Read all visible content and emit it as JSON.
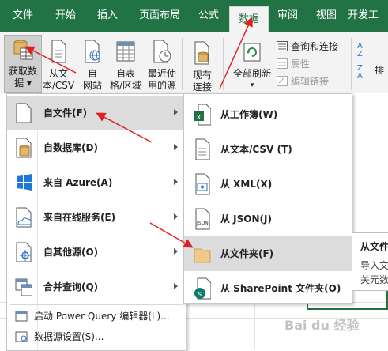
{
  "tabs": [
    "文件",
    "开始",
    "插入",
    "页面布局",
    "公式",
    "数据",
    "审阅",
    "视图",
    "开发工"
  ],
  "active_tab": "数据",
  "ribbon": {
    "get_data": [
      "获取数",
      "据 ▾"
    ],
    "from_text": [
      "从文",
      "本/CSV"
    ],
    "from_web": [
      "自",
      "网站"
    ],
    "from_table": [
      "自表",
      "格/区域"
    ],
    "recent_sources": [
      "最近使",
      "用的源"
    ],
    "existing_conn": [
      "现有",
      "连接"
    ],
    "refresh_all": [
      "全部刷新",
      "▾"
    ],
    "queries_conn": "查询和连接",
    "properties": "属性",
    "edit_links": "编辑链接",
    "sort_label": "排"
  },
  "menu": {
    "from_file": "自文件(F)",
    "from_database": "自数据库(D)",
    "from_azure": "来自 Azure(A)",
    "from_online": "来自在线服务(E)",
    "from_other": "自其他源(O)",
    "combine_queries": "合并查询(Q)",
    "launch_pq": "启动 Power Query 编辑器(L)...",
    "data_source_settings": "数据源设置(S)..."
  },
  "submenu": {
    "from_workbook": "从工作簿(W)",
    "from_text_csv": "从文本/CSV (T)",
    "from_xml": "从 XML(X)",
    "from_json": "从 JSON(J)",
    "from_folder": "从文件夹(F)",
    "from_sharepoint": "从 SharePoint 文件夹(O)"
  },
  "tooltip": {
    "title": "从文件",
    "line1": "导入文",
    "line2": "关元数"
  },
  "watermark": "Bai du 经验",
  "colors": {
    "excel_green": "#217346",
    "arrow_red": "#e02020",
    "menu_hover": "#dcdcdc"
  }
}
